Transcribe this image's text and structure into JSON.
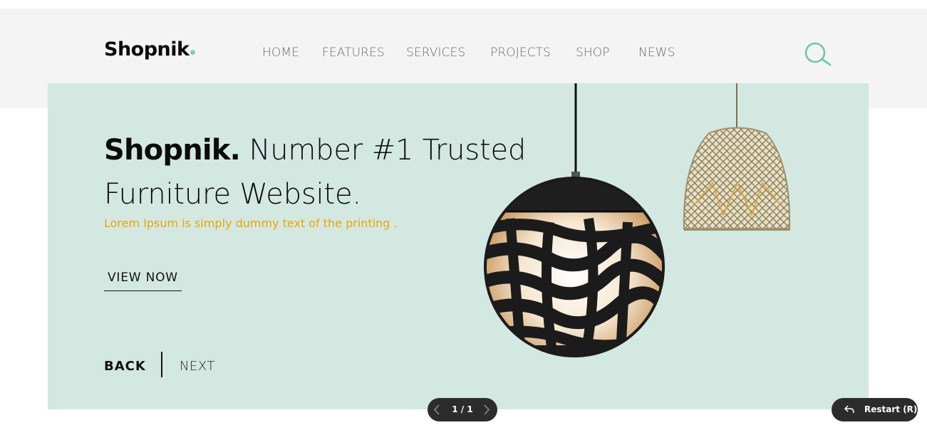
{
  "brand": {
    "name": "Shopnik",
    "accent_color": "#7fd1b4"
  },
  "nav": {
    "items": [
      "HOME",
      "FEATURES",
      "SERVICES",
      "PROJECTS",
      "SHOP",
      "NEWS"
    ],
    "search_icon": "search-icon"
  },
  "hero": {
    "headline_brand": "Shopnik.",
    "headline_rest_1": "Number #1 Trusted",
    "headline_rest_2": "Furniture Website.",
    "subtitle": "Lorem Ipsum is simply dummy text of the printing .",
    "cta_label": "VIEW NOW",
    "back_label": "BACK",
    "next_label": "NEXT",
    "background_color": "#d4e8e2",
    "subtitle_color": "#f0a400",
    "images": [
      "black-sphere-pendant-lamp",
      "wicker-pendant-lamp"
    ]
  },
  "pager": {
    "count": "1 / 1",
    "prev_icon": "chevron-left-icon",
    "next_icon": "chevron-right-icon"
  },
  "restart": {
    "label": "Restart (R)",
    "icon": "undo-arrow-icon"
  }
}
